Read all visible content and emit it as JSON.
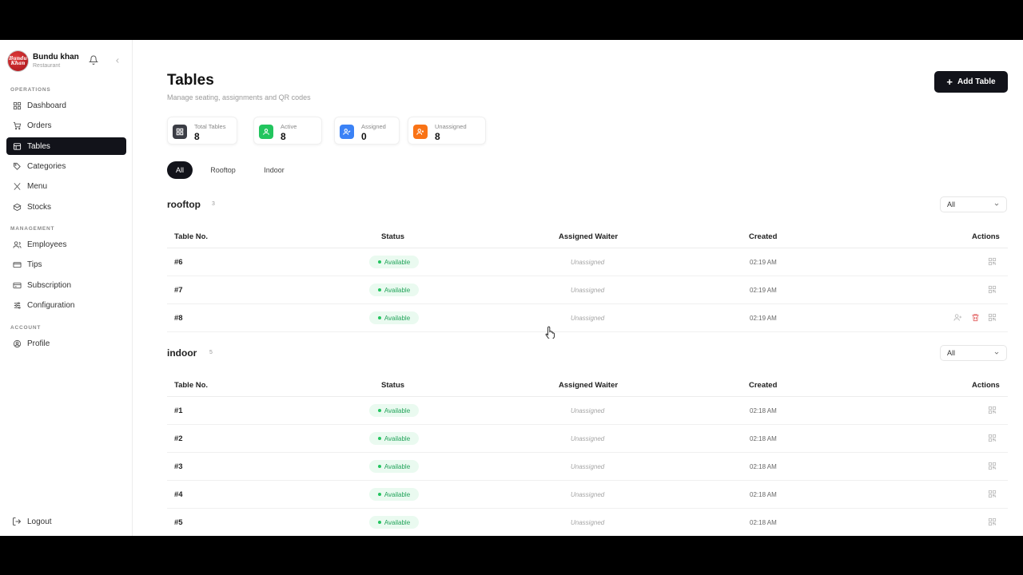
{
  "brand": {
    "name": "Bundu khan",
    "subtitle": "Restaurant",
    "logo_text": "Bundu Khan"
  },
  "sidebar": {
    "sections": [
      {
        "label": "OPERATIONS"
      },
      {
        "label": "MANAGEMENT"
      },
      {
        "label": "ACCOUNT"
      }
    ],
    "items": [
      {
        "label": "Dashboard",
        "icon": "grid-icon"
      },
      {
        "label": "Orders",
        "icon": "cart-icon"
      },
      {
        "label": "Tables",
        "icon": "table-icon",
        "active": true
      },
      {
        "label": "Categories",
        "icon": "tag-icon"
      },
      {
        "label": "Menu",
        "icon": "utensils-icon"
      },
      {
        "label": "Stocks",
        "icon": "box-icon"
      },
      {
        "label": "Employees",
        "icon": "users-icon"
      },
      {
        "label": "Tips",
        "icon": "wallet-icon"
      },
      {
        "label": "Subscription",
        "icon": "card-icon"
      },
      {
        "label": "Configuration",
        "icon": "sliders-icon"
      },
      {
        "label": "Profile",
        "icon": "user-circle-icon"
      }
    ],
    "logout_label": "Logout"
  },
  "header": {
    "title": "Tables",
    "subtitle": "Manage seating, assignments and QR codes",
    "add_button_label": "Add Table"
  },
  "stats": [
    {
      "label": "Total Tables",
      "value": "8",
      "color": "#3b3d45"
    },
    {
      "label": "Active",
      "value": "8",
      "color": "#22c55e"
    },
    {
      "label": "Assigned",
      "value": "0",
      "color": "#3b82f6"
    },
    {
      "label": "Unassigned",
      "value": "8",
      "color": "#f97316"
    }
  ],
  "filters": [
    {
      "label": "All",
      "active": true
    },
    {
      "label": "Rooftop",
      "active": false
    },
    {
      "label": "Indoor",
      "active": false
    }
  ],
  "columns": {
    "table_no": "Table No.",
    "status": "Status",
    "waiter": "Assigned Waiter",
    "created": "Created",
    "actions": "Actions"
  },
  "groups": [
    {
      "name": "rooftop",
      "count": "3",
      "select_value": "All",
      "rows": [
        {
          "no": "#6",
          "status": "Available",
          "waiter": "Unassigned",
          "created": "02:19 AM"
        },
        {
          "no": "#7",
          "status": "Available",
          "waiter": "Unassigned",
          "created": "02:19 AM"
        },
        {
          "no": "#8",
          "status": "Available",
          "waiter": "Unassigned",
          "created": "02:19 AM"
        }
      ]
    },
    {
      "name": "indoor",
      "count": "5",
      "select_value": "All",
      "rows": [
        {
          "no": "#1",
          "status": "Available",
          "waiter": "Unassigned",
          "created": "02:18 AM"
        },
        {
          "no": "#2",
          "status": "Available",
          "waiter": "Unassigned",
          "created": "02:18 AM"
        },
        {
          "no": "#3",
          "status": "Available",
          "waiter": "Unassigned",
          "created": "02:18 AM"
        },
        {
          "no": "#4",
          "status": "Available",
          "waiter": "Unassigned",
          "created": "02:18 AM"
        },
        {
          "no": "#5",
          "status": "Available",
          "waiter": "Unassigned",
          "created": "02:18 AM"
        }
      ]
    }
  ]
}
